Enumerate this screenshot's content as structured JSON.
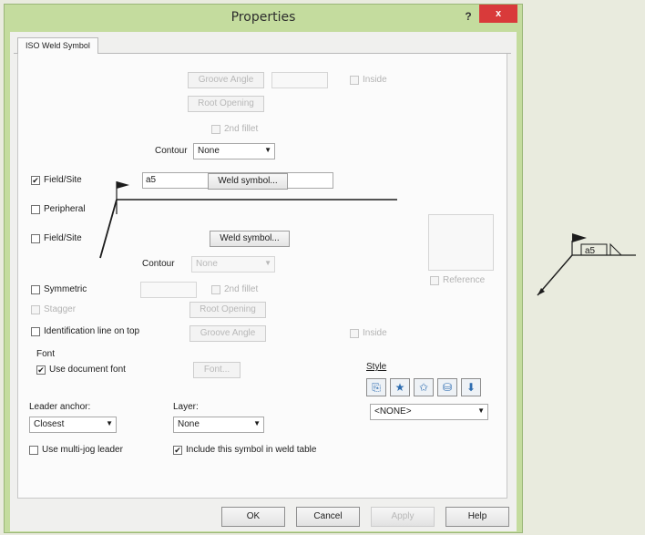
{
  "window": {
    "title": "Properties",
    "help_label": "?",
    "close_label": "x",
    "tab": "ISO Weld Symbol"
  },
  "top": {
    "groove_angle": "Groove Angle",
    "root_opening": "Root Opening",
    "inside": "Inside",
    "second_fillet": "2nd fillet",
    "contour_label": "Contour",
    "contour_value": "None"
  },
  "arrow_side": {
    "field_site": "Field/Site",
    "field_site_checked": true,
    "peripheral": "Peripheral",
    "peripheral_checked": false,
    "size_value": "a5",
    "weld_symbol_button": "Weld symbol..."
  },
  "other_side": {
    "field_site": "Field/Site",
    "field_site_checked": false,
    "weld_symbol_button": "Weld symbol...",
    "contour_label": "Contour",
    "contour_value": "None"
  },
  "reference_label": "Reference",
  "lower": {
    "symmetric": "Symmetric",
    "stagger": "Stagger",
    "second_fillet": "2nd fillet",
    "root_opening": "Root Opening",
    "identification_line": "Identification line on top",
    "groove_angle": "Groove Angle",
    "inside": "Inside"
  },
  "font": {
    "heading": "Font",
    "use_document_font": "Use document font",
    "use_document_font_checked": true,
    "font_button": "Font..."
  },
  "style": {
    "label": "Style",
    "value": "<NONE>",
    "icons": [
      "style-add-icon",
      "style-star-icon",
      "style-star-remove-icon",
      "style-save-icon",
      "style-load-icon"
    ]
  },
  "leader": {
    "anchor_label": "Leader anchor:",
    "anchor_value": "Closest",
    "layer_label": "Layer:",
    "layer_value": "None",
    "multi_jog": "Use multi-jog leader",
    "multi_jog_checked": false,
    "include_table": "Include this symbol in weld table",
    "include_table_checked": true
  },
  "buttons": {
    "ok": "OK",
    "cancel": "Cancel",
    "apply": "Apply",
    "help": "Help"
  },
  "preview": {
    "size_value": "a5"
  }
}
